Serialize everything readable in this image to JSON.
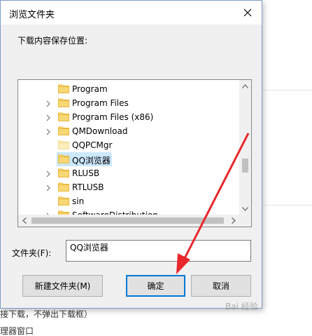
{
  "dialog": {
    "title": "浏览文件夹",
    "prompt": "下载内容保存位置:",
    "folder_label": "文件夹(F):",
    "folder_value": "QQ浏览器",
    "buttons": {
      "new_folder": "新建文件夹(M)",
      "ok": "确定",
      "cancel": "取消"
    }
  },
  "tree": {
    "items": [
      {
        "label": "Program",
        "expandable": false,
        "selected": false,
        "icon": "folder-icon"
      },
      {
        "label": "Program Files",
        "expandable": true,
        "selected": false,
        "icon": "folder-icon"
      },
      {
        "label": "Program Files (x86)",
        "expandable": true,
        "selected": false,
        "icon": "folder-icon"
      },
      {
        "label": "QMDownload",
        "expandable": true,
        "selected": false,
        "icon": "folder-icon"
      },
      {
        "label": "QQPCMgr",
        "expandable": false,
        "selected": false,
        "icon": "folder-light-icon"
      },
      {
        "label": "QQ浏览器",
        "expandable": false,
        "selected": true,
        "icon": "folder-icon"
      },
      {
        "label": "RLUSB",
        "expandable": true,
        "selected": false,
        "icon": "folder-icon"
      },
      {
        "label": "RTLUSB",
        "expandable": true,
        "selected": false,
        "icon": "folder-icon"
      },
      {
        "label": "sin",
        "expandable": false,
        "selected": false,
        "icon": "folder-icon"
      },
      {
        "label": "SoftwareDistribution",
        "expandable": true,
        "selected": false,
        "icon": "folder-icon"
      }
    ]
  },
  "background": {
    "fragment_1": "吉",
    "fragment_2": "载",
    "fragment_3": "未",
    "line_1": "接下载，不弹出下载框）",
    "line_2": "理器窗口"
  },
  "watermark": "Bai 经验",
  "colors": {
    "accent": "#0078d7",
    "selection": "#cce8ff",
    "annotation_arrow": "#e8262b",
    "folder": "#f8d775"
  }
}
